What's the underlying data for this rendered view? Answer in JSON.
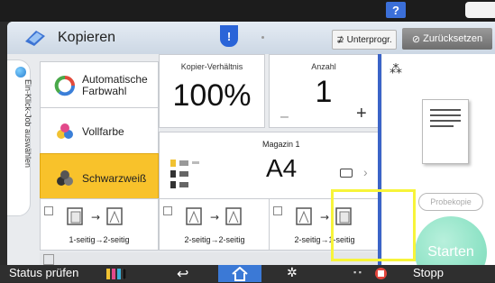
{
  "system": {
    "help_label": "?",
    "corner_label": "("
  },
  "header": {
    "title": "Kopieren",
    "info_badge": "!",
    "interrupt_label": "Unterprogr.",
    "reset_label": "Zurücksetzen"
  },
  "side_tab": {
    "label": "Ein-Klick-Job auswählen"
  },
  "color_modes": [
    {
      "label": "Automatische Farbwahl",
      "icon": "auto-color-icon",
      "selected": false
    },
    {
      "label": "Vollfarbe",
      "icon": "full-color-icon",
      "selected": false
    },
    {
      "label": "Schwarzweiß",
      "icon": "black-white-icon",
      "selected": true
    }
  ],
  "ratio": {
    "label": "Kopier-Verhältnis",
    "value": "100%"
  },
  "count": {
    "label": "Anzahl",
    "value": "1",
    "minus": "–",
    "plus": "+"
  },
  "paper": {
    "tray_label": "Magazin 1",
    "size": "A4",
    "chevron": "›"
  },
  "duplex": [
    {
      "label": "1-seitig→2-seitig",
      "icon": "one-to-two-sided-icon"
    },
    {
      "label": "2-seitig→2-seitig",
      "icon": "two-to-two-sided-icon"
    },
    {
      "label": "2-seitig→1-seitig",
      "icon": "two-to-one-sided-icon"
    }
  ],
  "preview": {
    "dots": "⁂",
    "proof_label": "Probekopie",
    "start_label": "Starten"
  },
  "bottom": {
    "status_label": "Status prüfen",
    "back": "↩",
    "settings": "✲",
    "dots": "▪ ▪",
    "stop_label": "Stopp"
  },
  "colors": {
    "accent": "#3b64c8",
    "selected": "#f8c22b",
    "start": "#8fe3c6",
    "highlight": "#f7f43a"
  }
}
